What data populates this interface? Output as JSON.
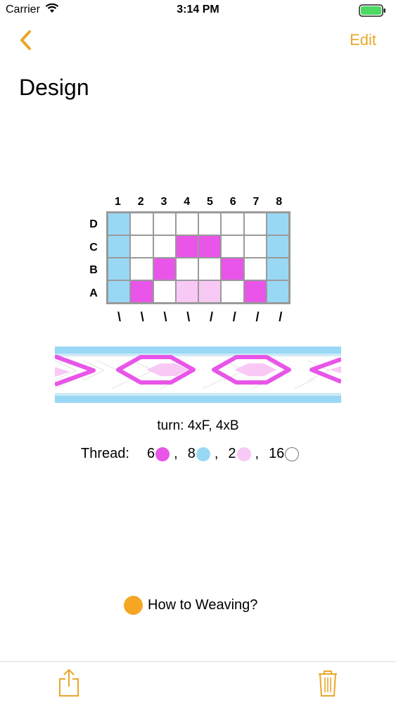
{
  "status_bar": {
    "carrier": "Carrier",
    "time": "3:14 PM"
  },
  "nav": {
    "back_icon": "chevron-left-icon",
    "edit_label": "Edit"
  },
  "page": {
    "title": "Design"
  },
  "pattern": {
    "columns": [
      "1",
      "2",
      "3",
      "4",
      "5",
      "6",
      "7",
      "8"
    ],
    "rows": [
      "D",
      "C",
      "B",
      "A"
    ],
    "colors": {
      "B": "#99D8F5",
      "M": "#E855E8",
      "P": "#F8C9F5",
      "W": "#FFFFFF"
    },
    "cells": [
      [
        "B",
        "W",
        "W",
        "W",
        "W",
        "W",
        "W",
        "B"
      ],
      [
        "B",
        "W",
        "W",
        "M",
        "M",
        "W",
        "W",
        "B"
      ],
      [
        "B",
        "W",
        "M",
        "W",
        "W",
        "M",
        "W",
        "B"
      ],
      [
        "B",
        "M",
        "W",
        "P",
        "P",
        "W",
        "M",
        "B"
      ]
    ],
    "threading": [
      "\\",
      "\\",
      "\\",
      "\\",
      "/",
      "/",
      "/",
      "/"
    ]
  },
  "info": {
    "turn_text": "turn: 4xF, 4xB",
    "thread_label": "Thread:",
    "threads": [
      {
        "count": "6",
        "color": "#E855E8",
        "sep": ","
      },
      {
        "count": "8",
        "color": "#99D8F5",
        "sep": ","
      },
      {
        "count": "2",
        "color": "#F8C9F5",
        "sep": ","
      },
      {
        "count": "16",
        "color": "#FFFFFF",
        "sep": ""
      }
    ]
  },
  "help": {
    "label": "How to Weaving?",
    "color": "#F5A623"
  },
  "toolbar": {
    "share_icon": "share-icon",
    "trash_icon": "trash-icon",
    "accent": "#E8A82A"
  }
}
